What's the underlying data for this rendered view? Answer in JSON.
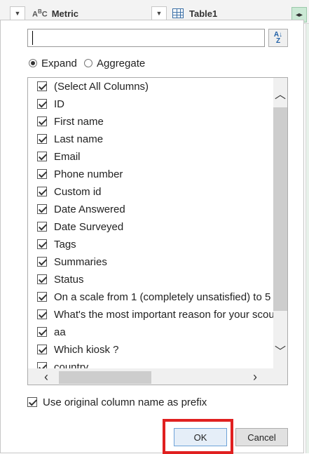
{
  "header": {
    "metric_label": "Metric",
    "table_label": "Table1",
    "type_icon_text": "ABC",
    "colors": {
      "accent_green": "#cbe9d5",
      "highlight_red": "#e02020"
    }
  },
  "search": {
    "value": "",
    "placeholder": ""
  },
  "sort_button_glyph": "A↓Z",
  "mode": {
    "expand_label": "Expand",
    "aggregate_label": "Aggregate",
    "selected": "Expand"
  },
  "columns": [
    {
      "label": "(Select All Columns)",
      "checked": true
    },
    {
      "label": "ID",
      "checked": true
    },
    {
      "label": "First name",
      "checked": true
    },
    {
      "label": "Last name",
      "checked": true
    },
    {
      "label": "Email",
      "checked": true
    },
    {
      "label": "Phone number",
      "checked": true
    },
    {
      "label": "Custom id",
      "checked": true
    },
    {
      "label": "Date Answered",
      "checked": true
    },
    {
      "label": "Date Surveyed",
      "checked": true
    },
    {
      "label": "Tags",
      "checked": true
    },
    {
      "label": "Summaries",
      "checked": true
    },
    {
      "label": "Status",
      "checked": true
    },
    {
      "label": "On a scale from 1 (completely unsatisfied) to 5",
      "checked": true
    },
    {
      "label": "What's the most important reason for your scou",
      "checked": true
    },
    {
      "label": "aa",
      "checked": true
    },
    {
      "label": "Which kiosk ?",
      "checked": true
    },
    {
      "label": "country",
      "checked": true
    }
  ],
  "prefix": {
    "label": "Use original column name as prefix",
    "checked": true
  },
  "buttons": {
    "ok": "OK",
    "cancel": "Cancel"
  }
}
